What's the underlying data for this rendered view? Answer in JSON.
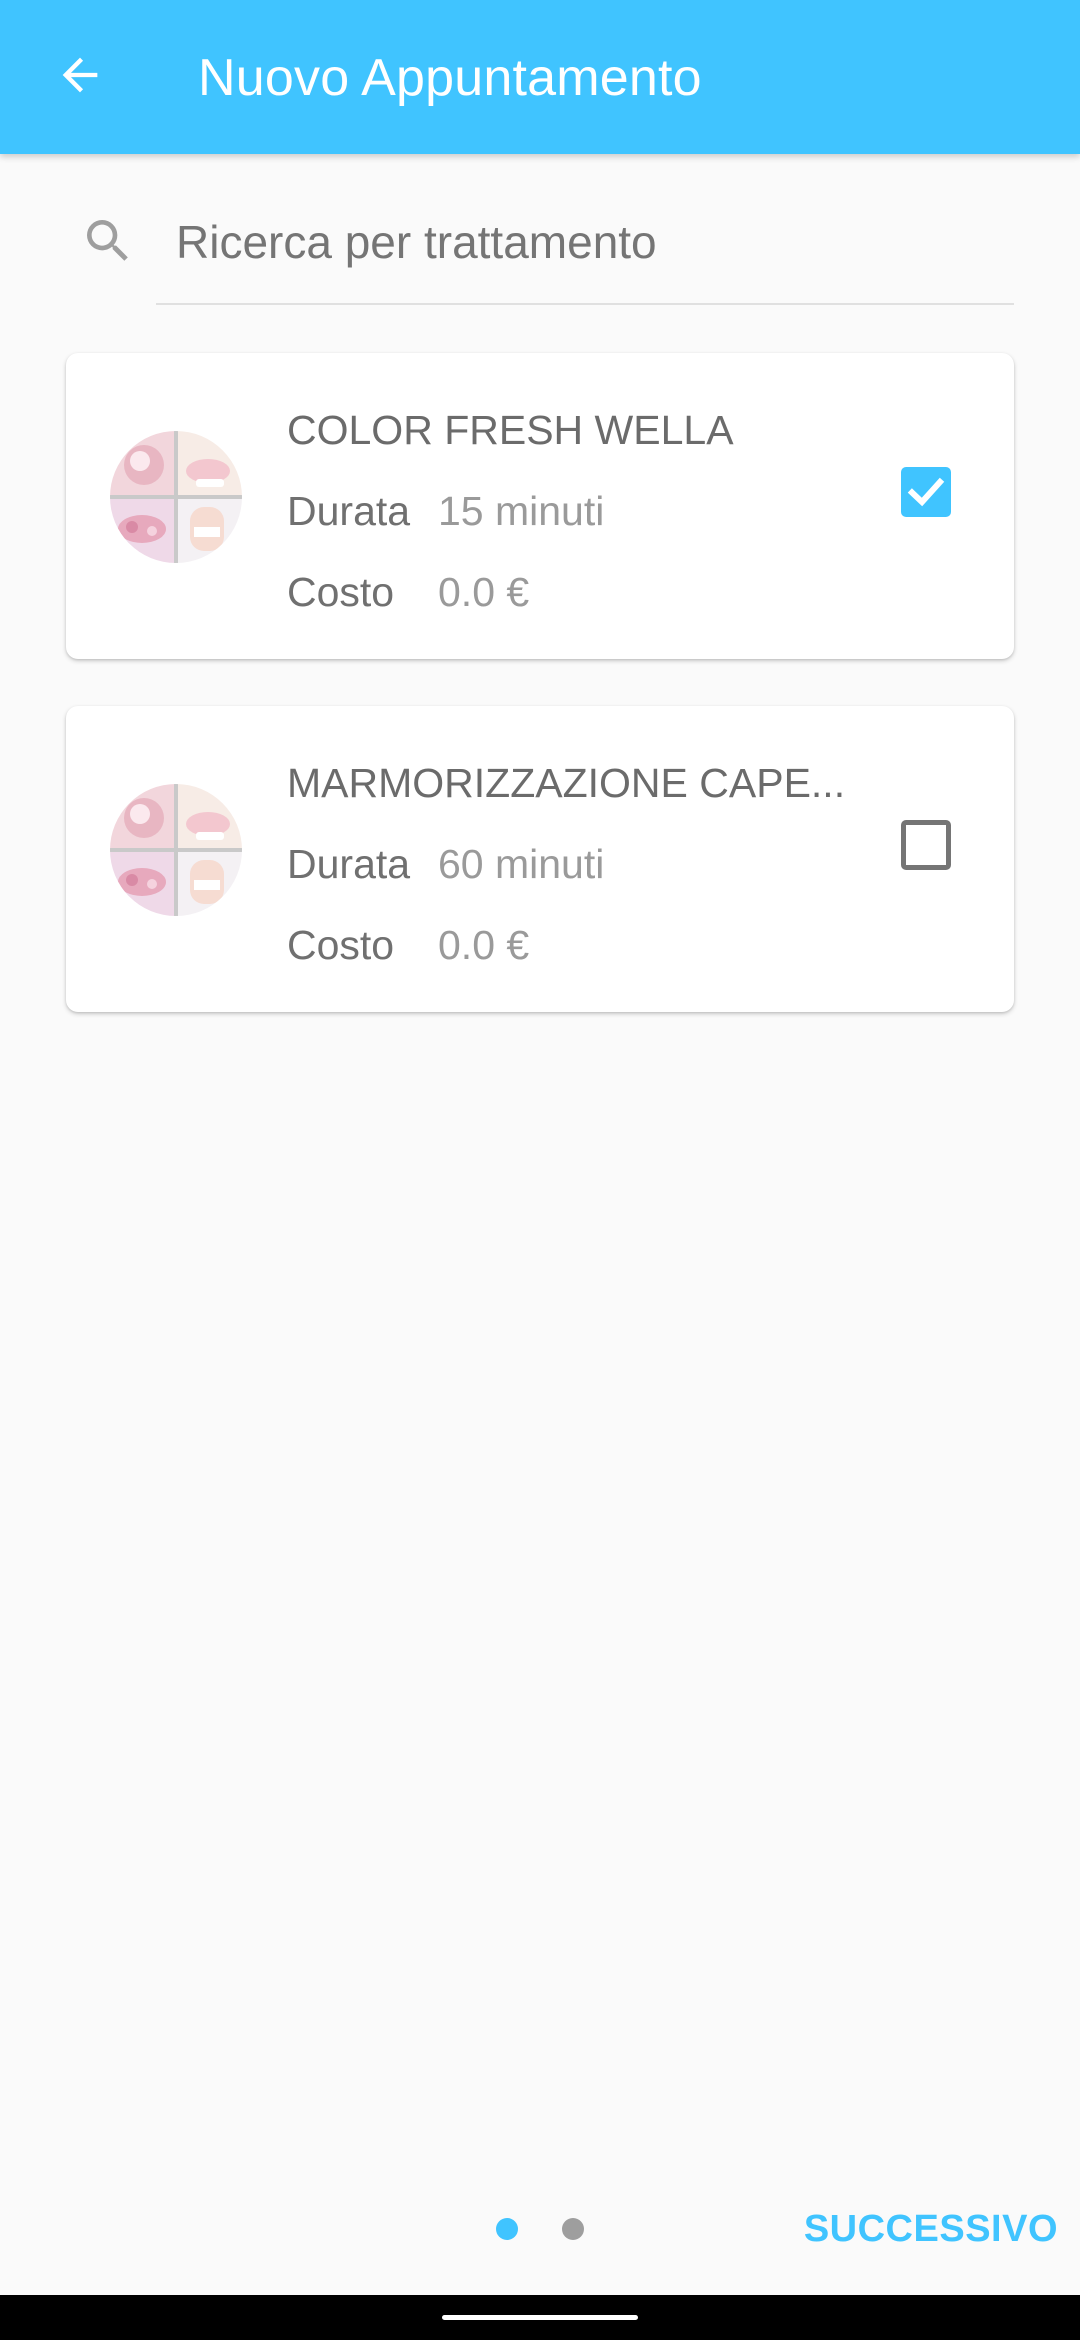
{
  "appbar": {
    "title": "Nuovo Appuntamento",
    "back_icon": "arrow-back-icon",
    "color": "#40c4ff"
  },
  "search": {
    "placeholder": "Ricerca per trattamento",
    "value": "",
    "icon": "search-icon"
  },
  "treatments": [
    {
      "name": "COLOR FRESH WELLA",
      "durata_label": "Durata",
      "durata_value": "15 minuti",
      "costo_label": "Costo",
      "costo_value": "0.0 €",
      "checked": true
    },
    {
      "name": "MARMORIZZAZIONE CAPE...",
      "durata_label": "Durata",
      "durata_value": "60 minuti",
      "costo_label": "Costo",
      "costo_value": "0.0 €",
      "checked": false
    }
  ],
  "pager": {
    "pages": 2,
    "current": 1
  },
  "footer": {
    "next_label": "SUCCESSIVO"
  }
}
